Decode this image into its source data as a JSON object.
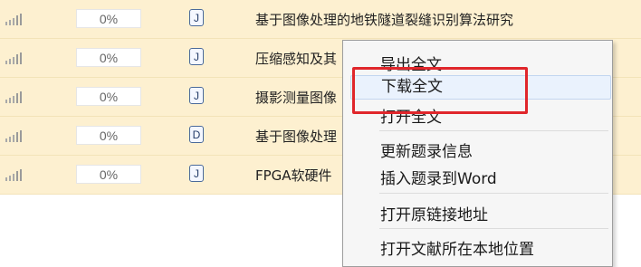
{
  "rows": [
    {
      "progress": "0%",
      "type": "J",
      "title": "基于图像处理的地铁隧道裂缝识别算法研究"
    },
    {
      "progress": "0%",
      "type": "J",
      "title": "压缩感知及其"
    },
    {
      "progress": "0%",
      "type": "J",
      "title": "摄影测量图像"
    },
    {
      "progress": "0%",
      "type": "D",
      "title": "基于图像处理"
    },
    {
      "progress": "0%",
      "type": "J",
      "title": "FPGA软硬件"
    }
  ],
  "menu": {
    "export": "导出全文",
    "download": "下载全文",
    "open": "打开全文",
    "update": "更新题录信息",
    "insert_word": "插入题录到Word",
    "open_link": "打开原链接地址",
    "open_location": "打开文献所在本地位置"
  },
  "colors": {
    "row_bg": "#fdf0d0",
    "highlight_bg": "#eaf2fd",
    "annotation": "#e0262b"
  },
  "icons": {
    "signal": "signal-strength-icon",
    "type": "document-type-icon"
  }
}
